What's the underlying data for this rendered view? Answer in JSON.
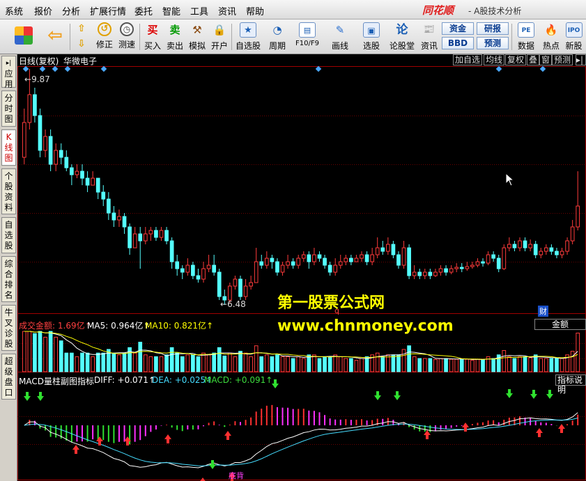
{
  "menubar": {
    "items": [
      "系统",
      "报价",
      "分析",
      "扩展行情",
      "委托",
      "智能",
      "工具",
      "资讯",
      "帮助"
    ],
    "brand": "同花顺",
    "subtitle": "- A股技术分析"
  },
  "toolbar": {
    "buttons": [
      "修正",
      "测速",
      "买入",
      "卖出",
      "模拟",
      "开户",
      "自选股",
      "周期",
      "F10/F9",
      "画线",
      "选股",
      "论股堂",
      "资讯",
      "数据",
      "热点",
      "新股"
    ],
    "buy_icon": "买",
    "sell_icon": "卖",
    "lungu_icon": "论",
    "small_buttons": [
      "资金",
      "研报",
      "BBD",
      "预测"
    ]
  },
  "sidetabs": [
    "应用",
    "分时图",
    "K线图",
    "个股资料",
    "自选股",
    "综合排名",
    "牛叉诊股",
    "超级盘口"
  ],
  "chart_header": {
    "period": "日线(复权)",
    "stock_name": "华微电子",
    "right_buttons": [
      "加自选",
      "均线",
      "复权",
      "叠",
      "窗",
      "预测"
    ],
    "high_label": "9.87",
    "low_label": "6.48",
    "q_marker": "q",
    "cai_marker": "财"
  },
  "volume_panel": {
    "title": "成交金额:",
    "value": "1.69亿",
    "ma5_label": "MA5:",
    "ma5": "0.964亿",
    "ma10_label": "MA10:",
    "ma10": "0.821亿",
    "right_label": "金额"
  },
  "macd_panel": {
    "title": "MACD量柱副图指标",
    "diff_label": "DIFF:",
    "diff": "+0.071",
    "dea_label": "DEA:",
    "dea": "+0.025",
    "macd_label": "MACD:",
    "macd": "+0.091",
    "right_label": "指标说明",
    "marker": "底背"
  },
  "watermark": {
    "line1": "第一股票公式网",
    "line2": "www.chnmoney.com"
  },
  "colors": {
    "up": "#ff3b3b",
    "down": "#54ffff",
    "volume_title": "#ff4040",
    "ma5": "#ffffff",
    "ma10": "#ffff00",
    "diff": "#ffffff",
    "dea": "#ffff00",
    "macd": "#ff00ff",
    "watermark": "#ffff00"
  },
  "chart_data": {
    "type": "candlestick",
    "price_high": 9.87,
    "price_low": 6.48,
    "candles": [
      [
        8.6,
        9.1,
        9.3,
        8.5
      ],
      [
        9.1,
        9.5,
        9.87,
        9.0
      ],
      [
        9.5,
        9.2,
        9.6,
        9.1
      ],
      [
        9.2,
        8.7,
        9.3,
        8.6
      ],
      [
        8.7,
        8.9,
        9.0,
        8.6
      ],
      [
        8.9,
        8.5,
        9.0,
        8.4
      ],
      [
        8.5,
        8.7,
        8.8,
        8.4
      ],
      [
        8.7,
        8.6,
        8.8,
        8.5
      ],
      [
        8.6,
        8.45,
        8.7,
        8.4
      ],
      [
        8.45,
        8.35,
        8.5,
        8.2
      ],
      [
        8.35,
        8.4,
        8.5,
        8.3
      ],
      [
        8.4,
        8.3,
        8.5,
        8.2
      ],
      [
        8.3,
        8.2,
        8.4,
        8.1
      ],
      [
        8.2,
        8.3,
        8.4,
        8.2
      ],
      [
        8.3,
        8.1,
        8.3,
        8.0
      ],
      [
        8.1,
        8.0,
        8.2,
        7.9
      ],
      [
        8.0,
        7.8,
        8.1,
        7.7
      ],
      [
        7.8,
        7.7,
        7.9,
        7.6
      ],
      [
        7.7,
        7.75,
        7.85,
        7.6
      ],
      [
        7.75,
        7.6,
        7.8,
        7.5
      ],
      [
        7.6,
        7.3,
        7.65,
        7.2
      ],
      [
        7.3,
        7.5,
        7.6,
        7.3
      ],
      [
        7.5,
        7.4,
        7.6,
        7.0
      ],
      [
        7.4,
        7.5,
        7.6,
        7.35
      ],
      [
        7.5,
        7.55,
        7.6,
        7.4
      ],
      [
        7.55,
        7.45,
        7.6,
        7.4
      ],
      [
        7.45,
        7.55,
        7.6,
        7.4
      ],
      [
        7.55,
        7.4,
        7.6,
        7.35
      ],
      [
        7.4,
        7.1,
        7.45,
        7.0
      ],
      [
        7.1,
        7.0,
        7.2,
        6.9
      ],
      [
        7.0,
        6.95,
        7.05,
        6.85
      ],
      [
        6.95,
        7.05,
        7.15,
        6.9
      ],
      [
        7.05,
        6.9,
        7.1,
        6.85
      ],
      [
        6.9,
        6.85,
        7.0,
        6.8
      ],
      [
        6.85,
        7.0,
        7.1,
        6.8
      ],
      [
        7.0,
        7.05,
        7.2,
        6.95
      ],
      [
        7.05,
        6.95,
        7.2,
        6.9
      ],
      [
        6.95,
        6.6,
        7.0,
        6.55
      ],
      [
        6.6,
        6.55,
        6.7,
        6.48
      ],
      [
        6.55,
        6.75,
        6.8,
        6.5
      ],
      [
        6.75,
        6.85,
        6.9,
        6.7
      ],
      [
        6.85,
        6.6,
        6.9,
        6.55
      ],
      [
        6.6,
        6.75,
        6.85,
        6.55
      ],
      [
        6.75,
        6.8,
        6.9,
        6.7
      ],
      [
        6.8,
        7.1,
        7.3,
        6.8
      ],
      [
        7.1,
        7.05,
        7.2,
        7.0
      ],
      [
        7.05,
        7.15,
        7.25,
        7.0
      ],
      [
        7.15,
        7.1,
        7.2,
        7.0
      ],
      [
        7.1,
        6.95,
        7.15,
        6.9
      ],
      [
        6.95,
        7.05,
        7.1,
        6.9
      ],
      [
        7.05,
        7.1,
        7.2,
        7.0
      ],
      [
        7.1,
        7.05,
        7.15,
        7.0
      ],
      [
        7.05,
        7.15,
        7.2,
        7.0
      ],
      [
        7.15,
        7.2,
        7.25,
        7.1
      ],
      [
        7.2,
        7.1,
        7.25,
        7.0
      ],
      [
        7.1,
        7.2,
        7.3,
        7.05
      ],
      [
        7.2,
        7.15,
        7.25,
        7.1
      ],
      [
        7.15,
        7.05,
        7.2,
        7.0
      ],
      [
        7.05,
        6.95,
        7.1,
        6.9
      ],
      [
        6.95,
        7.05,
        7.15,
        6.9
      ],
      [
        7.05,
        7.1,
        7.2,
        7.0
      ],
      [
        7.1,
        7.15,
        7.2,
        7.05
      ],
      [
        7.15,
        7.1,
        7.2,
        7.05
      ],
      [
        7.1,
        7.15,
        7.2,
        7.1
      ],
      [
        7.15,
        7.2,
        7.25,
        7.1
      ],
      [
        7.2,
        7.1,
        7.25,
        7.05
      ],
      [
        7.1,
        7.2,
        7.3,
        7.05
      ],
      [
        7.2,
        7.3,
        7.45,
        7.15
      ],
      [
        7.3,
        7.25,
        7.4,
        7.2
      ],
      [
        7.25,
        7.35,
        7.45,
        7.2
      ],
      [
        7.35,
        7.2,
        7.4,
        7.15
      ],
      [
        7.2,
        7.05,
        7.25,
        7.0
      ],
      [
        7.05,
        7.3,
        7.4,
        7.0
      ],
      [
        7.3,
        6.9,
        7.35,
        6.85
      ],
      [
        6.9,
        6.95,
        7.05,
        6.85
      ],
      [
        6.95,
        6.9,
        7.0,
        6.85
      ],
      [
        6.9,
        6.95,
        7.0,
        6.85
      ],
      [
        6.95,
        6.9,
        7.0,
        6.85
      ],
      [
        6.9,
        6.95,
        7.0,
        6.88
      ],
      [
        6.95,
        7.0,
        7.05,
        6.9
      ],
      [
        7.0,
        6.95,
        7.05,
        6.9
      ],
      [
        6.95,
        7.0,
        7.05,
        6.92
      ],
      [
        7.0,
        7.02,
        7.08,
        6.95
      ],
      [
        7.02,
        7.0,
        7.08,
        6.95
      ],
      [
        7.0,
        7.03,
        7.1,
        6.97
      ],
      [
        7.03,
        7.05,
        7.1,
        7.0
      ],
      [
        7.05,
        7.1,
        7.15,
        7.02
      ],
      [
        7.1,
        7.08,
        7.15,
        7.03
      ],
      [
        7.08,
        7.2,
        7.25,
        7.05
      ],
      [
        7.2,
        7.15,
        7.25,
        7.1
      ],
      [
        7.15,
        7.0,
        7.2,
        6.95
      ],
      [
        7.0,
        7.3,
        7.35,
        6.98
      ],
      [
        7.3,
        7.35,
        7.45,
        7.25
      ],
      [
        7.35,
        7.3,
        7.4,
        7.25
      ],
      [
        7.3,
        7.4,
        7.45,
        7.25
      ],
      [
        7.4,
        7.3,
        7.45,
        7.25
      ],
      [
        7.3,
        7.35,
        7.42,
        7.25
      ],
      [
        7.35,
        7.2,
        7.4,
        7.15
      ],
      [
        7.2,
        7.25,
        7.3,
        7.15
      ],
      [
        7.25,
        7.3,
        7.35,
        7.2
      ],
      [
        7.3,
        7.25,
        7.35,
        7.2
      ],
      [
        7.25,
        7.2,
        7.3,
        7.15
      ],
      [
        7.2,
        7.25,
        7.3,
        7.15
      ],
      [
        7.25,
        7.4,
        7.45,
        7.2
      ],
      [
        7.4,
        7.6,
        7.7,
        7.35
      ],
      [
        7.6,
        7.9,
        8.4,
        7.55
      ]
    ]
  }
}
